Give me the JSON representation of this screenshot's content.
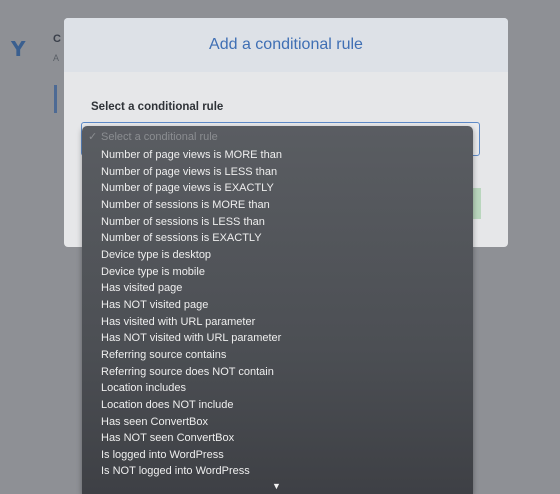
{
  "background": {
    "title": "C",
    "subtitle": "A"
  },
  "modal": {
    "title": "Add a conditional rule",
    "field_label": "Select a conditional rule"
  },
  "dropdown": {
    "selected": "Select a conditional rule",
    "check": "✓",
    "options": [
      "Number of page views is MORE than",
      "Number of page views is LESS than",
      "Number of page views is EXACTLY",
      "Number of sessions is MORE than",
      "Number of sessions is LESS than",
      "Number of sessions is EXACTLY",
      "Device type is desktop",
      "Device type is mobile",
      "Has visited page",
      "Has NOT visited page",
      "Has visited with URL parameter",
      "Has NOT visited with URL parameter",
      "Referring source contains",
      "Referring source does NOT contain",
      "Location includes",
      "Location does NOT include",
      "Has seen ConvertBox",
      "Has NOT seen ConvertBox",
      "Is logged into WordPress",
      "Is NOT logged into WordPress"
    ],
    "scroll_arrow": "▼"
  },
  "colors": {
    "accent": "#3f6fb4",
    "select_border": "#5d8ac7",
    "overlay": "#8e9095",
    "dropdown_bg": "#4c4f54"
  }
}
